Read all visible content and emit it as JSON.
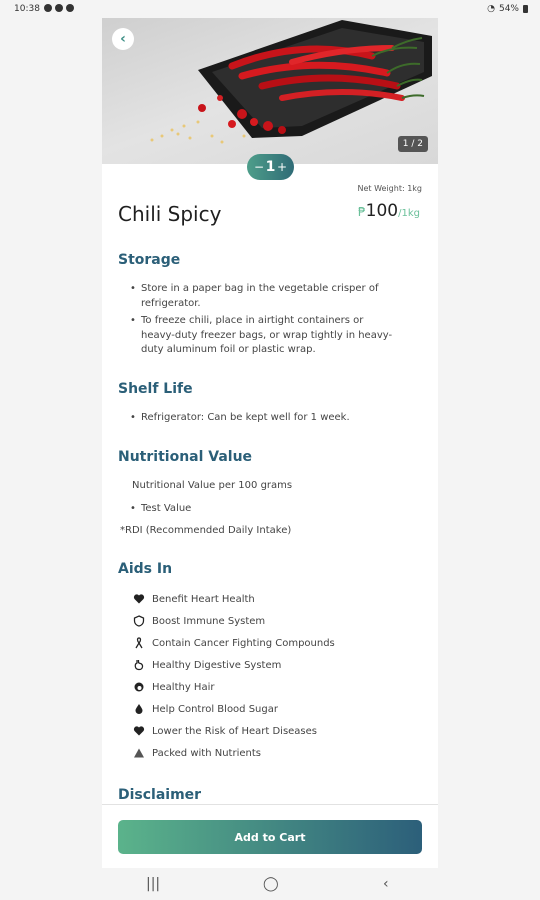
{
  "status_bar": {
    "time": "10:38",
    "battery": "54%"
  },
  "product": {
    "name": "Chili Spicy",
    "net_weight": "Net Weight: 1kg",
    "price_currency": "₱",
    "price_amount": "100",
    "price_unit": "/1kg",
    "image_pager": "1 / 2",
    "quantity": "1",
    "qty_minus": "−",
    "qty_plus": "+"
  },
  "storage": {
    "title": "Storage",
    "items": [
      "Store in a paper bag in the vegetable crisper of refrigerator.",
      "To freeze chili, place in airtight containers or heavy-duty freezer bags, or wrap tightly in heavy-duty aluminum foil or plastic wrap."
    ]
  },
  "shelf_life": {
    "title": "Shelf Life",
    "items": [
      "Refrigerator: Can be kept well for 1 week."
    ]
  },
  "nutrition": {
    "title": "Nutritional Value",
    "subtitle": "Nutritional Value per 100 grams",
    "items": [
      "Test Value"
    ],
    "footnote": "*RDI (Recommended Daily Intake)"
  },
  "aids": {
    "title": "Aids In",
    "items": [
      {
        "label": "Benefit Heart Health",
        "icon": "heart-icon"
      },
      {
        "label": "Boost Immune System",
        "icon": "shield-icon"
      },
      {
        "label": "Contain Cancer Fighting Compounds",
        "icon": "ribbon-icon"
      },
      {
        "label": "Healthy Digestive System",
        "icon": "stomach-icon"
      },
      {
        "label": "Healthy Hair",
        "icon": "hair-icon"
      },
      {
        "label": "Help Control Blood Sugar",
        "icon": "blood-drop-icon"
      },
      {
        "label": "Lower the Risk of Heart Diseases",
        "icon": "heart-outline-icon"
      },
      {
        "label": "Packed with Nutrients",
        "icon": "triangle-icon"
      }
    ]
  },
  "disclaimer": {
    "title": "Disclaimer"
  },
  "actions": {
    "add_to_cart": "Add to Cart"
  },
  "colors": {
    "accent_green": "#5bb38b",
    "accent_blue": "#2c5f7a",
    "heading": "#2b5f78"
  }
}
